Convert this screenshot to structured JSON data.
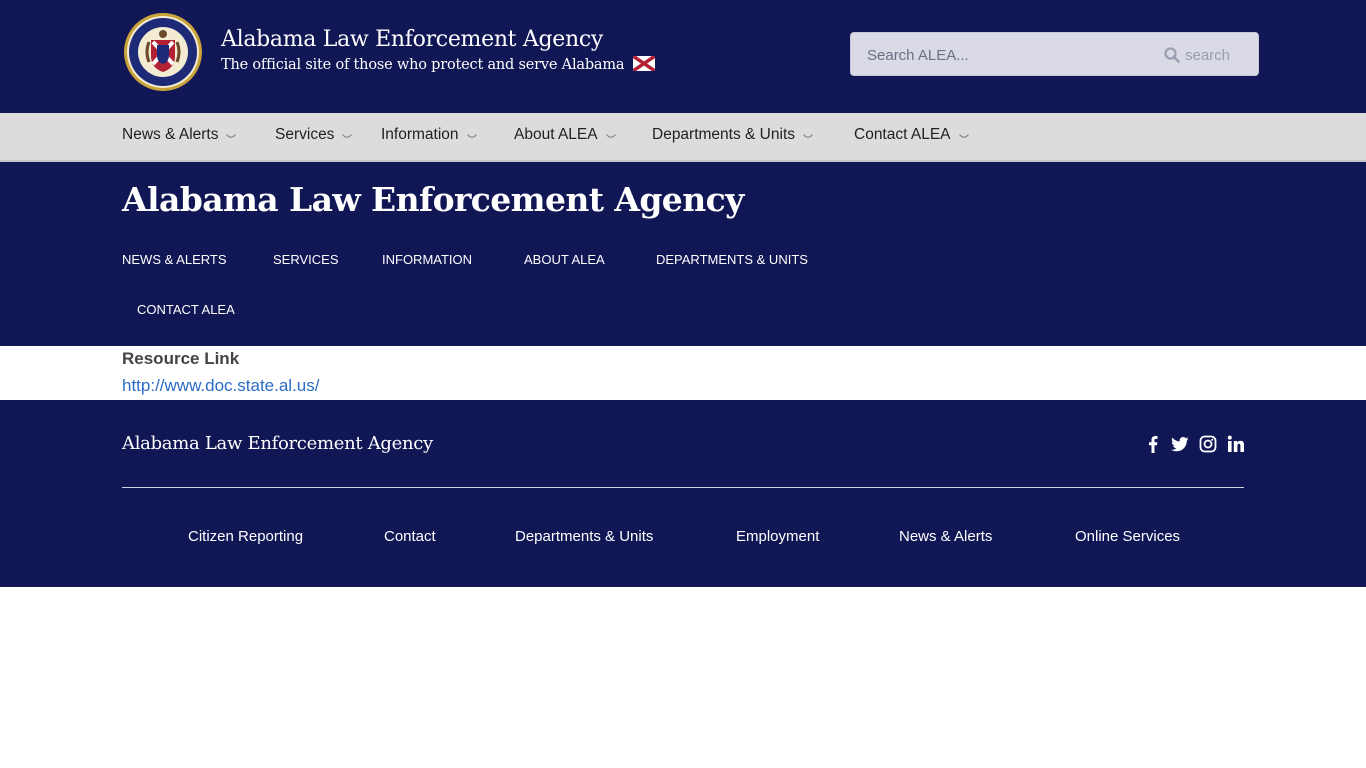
{
  "header": {
    "title": "Alabama Law Enforcement Agency",
    "tagline": "The official site of those who protect and serve Alabama",
    "seal_icon": "alea-seal-icon",
    "flag_icon": "alabama-flag-icon"
  },
  "search": {
    "placeholder": "Search ALEA...",
    "button_label": "search",
    "icon": "search-icon"
  },
  "main_nav": {
    "items": [
      {
        "label": "News & Alerts"
      },
      {
        "label": "Services"
      },
      {
        "label": "Information"
      },
      {
        "label": "About ALEA"
      },
      {
        "label": "Departments & Units"
      },
      {
        "label": "Contact ALEA"
      }
    ]
  },
  "hero": {
    "title": "Alabama Law Enforcement Agency",
    "sub_nav": [
      {
        "label": "NEWS & ALERTS"
      },
      {
        "label": "SERVICES"
      },
      {
        "label": "INFORMATION"
      },
      {
        "label": "ABOUT ALEA"
      },
      {
        "label": "DEPARTMENTS & UNITS"
      },
      {
        "label": "CONTACT ALEA"
      }
    ]
  },
  "content": {
    "resource_label": "Resource Link",
    "resource_url": "http://www.doc.state.al.us/"
  },
  "footer": {
    "title": "Alabama Law Enforcement Agency",
    "social_icons": [
      "facebook-icon",
      "twitter-icon",
      "instagram-icon",
      "linkedin-icon"
    ],
    "links": [
      {
        "label": "Citizen Reporting"
      },
      {
        "label": "Contact"
      },
      {
        "label": "Departments & Units"
      },
      {
        "label": "Employment"
      },
      {
        "label": "News & Alerts"
      },
      {
        "label": "Online Services"
      }
    ]
  },
  "colors": {
    "navy": "#111655",
    "nav_gray": "#dcdcdc",
    "link_blue": "#2b6cc4",
    "white": "#ffffff"
  }
}
